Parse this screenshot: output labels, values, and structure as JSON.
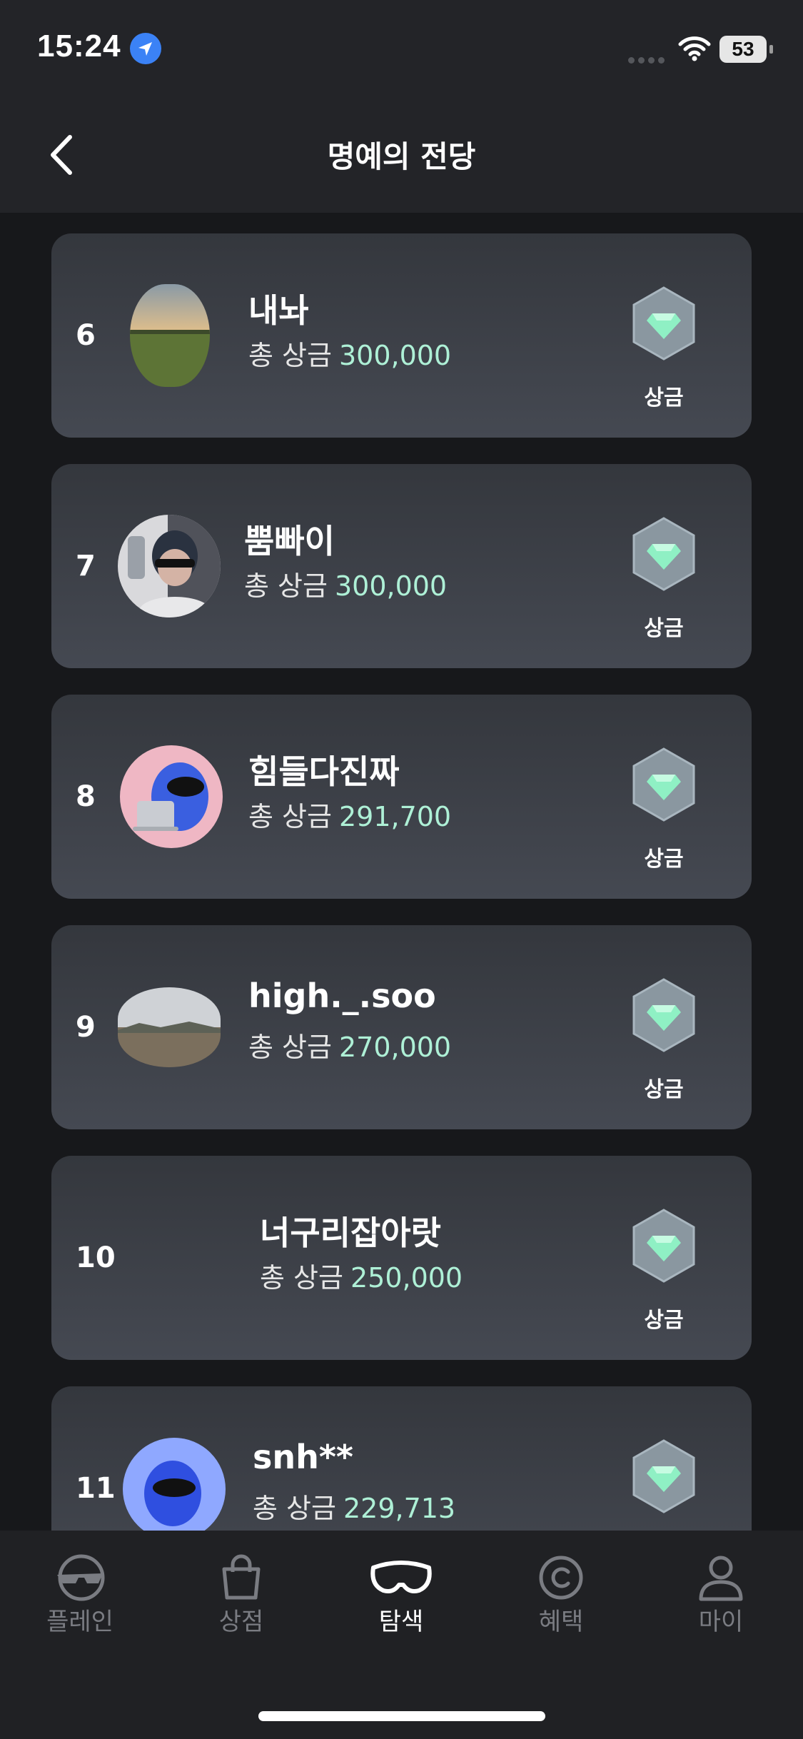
{
  "status": {
    "time": "15:24",
    "battery": "53"
  },
  "header": {
    "title": "명예의 전당"
  },
  "entries": [
    {
      "rank": "6",
      "name": "내놔",
      "prize_label": "총 상금",
      "amount": "300,000",
      "badge_label": "상금",
      "avatar": "landscape-sunset"
    },
    {
      "rank": "7",
      "name": "뿜빠이",
      "prize_label": "총 상금",
      "amount": "300,000",
      "badge_label": "상금",
      "avatar": "person-sunglasses"
    },
    {
      "rank": "8",
      "name": "힘들다진짜",
      "prize_label": "총 상금",
      "amount": "291,700",
      "badge_label": "상금",
      "avatar": "blue-character-laptop"
    },
    {
      "rank": "9",
      "name": "high._.soo",
      "prize_label": "총 상금",
      "amount": "270,000",
      "badge_label": "상금",
      "avatar": "field-landscape"
    },
    {
      "rank": "10",
      "name": "너구리잡아랏",
      "prize_label": "총 상금",
      "amount": "250,000",
      "badge_label": "상금",
      "avatar": "none"
    },
    {
      "rank": "11",
      "name": "snh**",
      "prize_label": "총 상금",
      "amount": "229,713",
      "badge_label": "",
      "avatar": "blue-character"
    }
  ],
  "tabs": [
    {
      "label": "플레인",
      "icon": "avatar-sunglasses-icon",
      "active": false
    },
    {
      "label": "상점",
      "icon": "shopping-bag-icon",
      "active": false
    },
    {
      "label": "탐색",
      "icon": "goggles-icon",
      "active": true
    },
    {
      "label": "혜택",
      "icon": "coin-icon",
      "active": false
    },
    {
      "label": "마이",
      "icon": "user-icon",
      "active": false
    }
  ],
  "colors": {
    "accent_amount": "#aef0d6",
    "gem": "#8ff0c4",
    "background": "#17181b",
    "card": "#3d4047"
  }
}
